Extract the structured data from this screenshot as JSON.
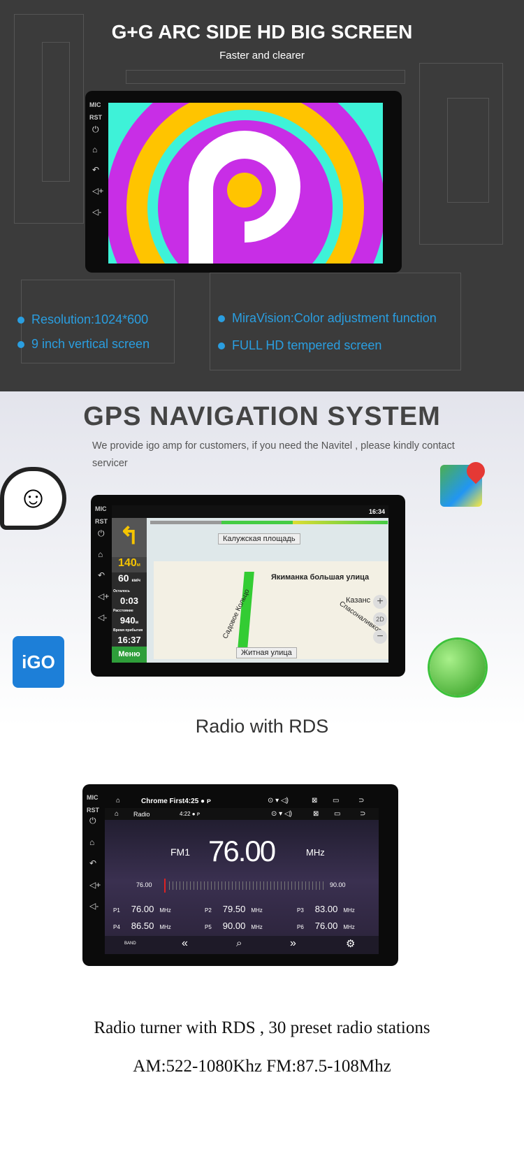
{
  "banner": {
    "title": "G+G ARC SIDE HD BIG SCREEN",
    "subtitle": "Faster and clearer",
    "features": [
      "Resolution:1024*600",
      "MiraVision:Color adjustment function",
      "9 inch vertical screen",
      "FULL HD tempered screen"
    ]
  },
  "device": {
    "mic": "MIC",
    "rst": "RST"
  },
  "gps": {
    "title": "GPS NAVIGATION SYSTEM",
    "description": "We provide igo amp for customers, if you need the Navitel , please kindly contact servicer",
    "clock": "16:34",
    "street_top": "Калужская площадь",
    "street_bottom": "Житная улица",
    "street_right": "Якиманка большая улица",
    "street_ring": "Садовое Кольцо",
    "street_kazan": "Казанс",
    "street_spas": "Спасоналивков",
    "distance": "140",
    "distance_unit": "м",
    "speed": "60",
    "speed_unit": "км/ч",
    "remaining_label": "Осталось",
    "remaining": "0:03",
    "dist_label": "Расстояние",
    "dist": "940",
    "dist_unit": "м",
    "arrival_label": "Время прибытия",
    "arrival": "16:37",
    "menu": "Меню",
    "mode": "2D",
    "igo": "iGO"
  },
  "radio_section": {
    "title": "Radio with RDS"
  },
  "radio": {
    "bar1_app": "Chrome First",
    "bar1_time": "4:25",
    "bar2_app": "Radio",
    "bar2_time": "4:22",
    "band": "FM1",
    "frequency": "76.00",
    "unit": "MHz",
    "scale_min": "76.00",
    "scale_max": "90.00",
    "presets": [
      {
        "label": "P1",
        "freq": "76.00"
      },
      {
        "label": "P2",
        "freq": "79.50"
      },
      {
        "label": "P3",
        "freq": "83.00"
      },
      {
        "label": "P4",
        "freq": "86.50"
      },
      {
        "label": "P5",
        "freq": "90.00"
      },
      {
        "label": "P6",
        "freq": "76.00"
      }
    ],
    "band_button": "BAND"
  },
  "footer": {
    "line1": "Radio turner with RDS , 30 preset radio stations",
    "line2": "AM:522-1080Khz  FM:87.5-108Mhz"
  }
}
